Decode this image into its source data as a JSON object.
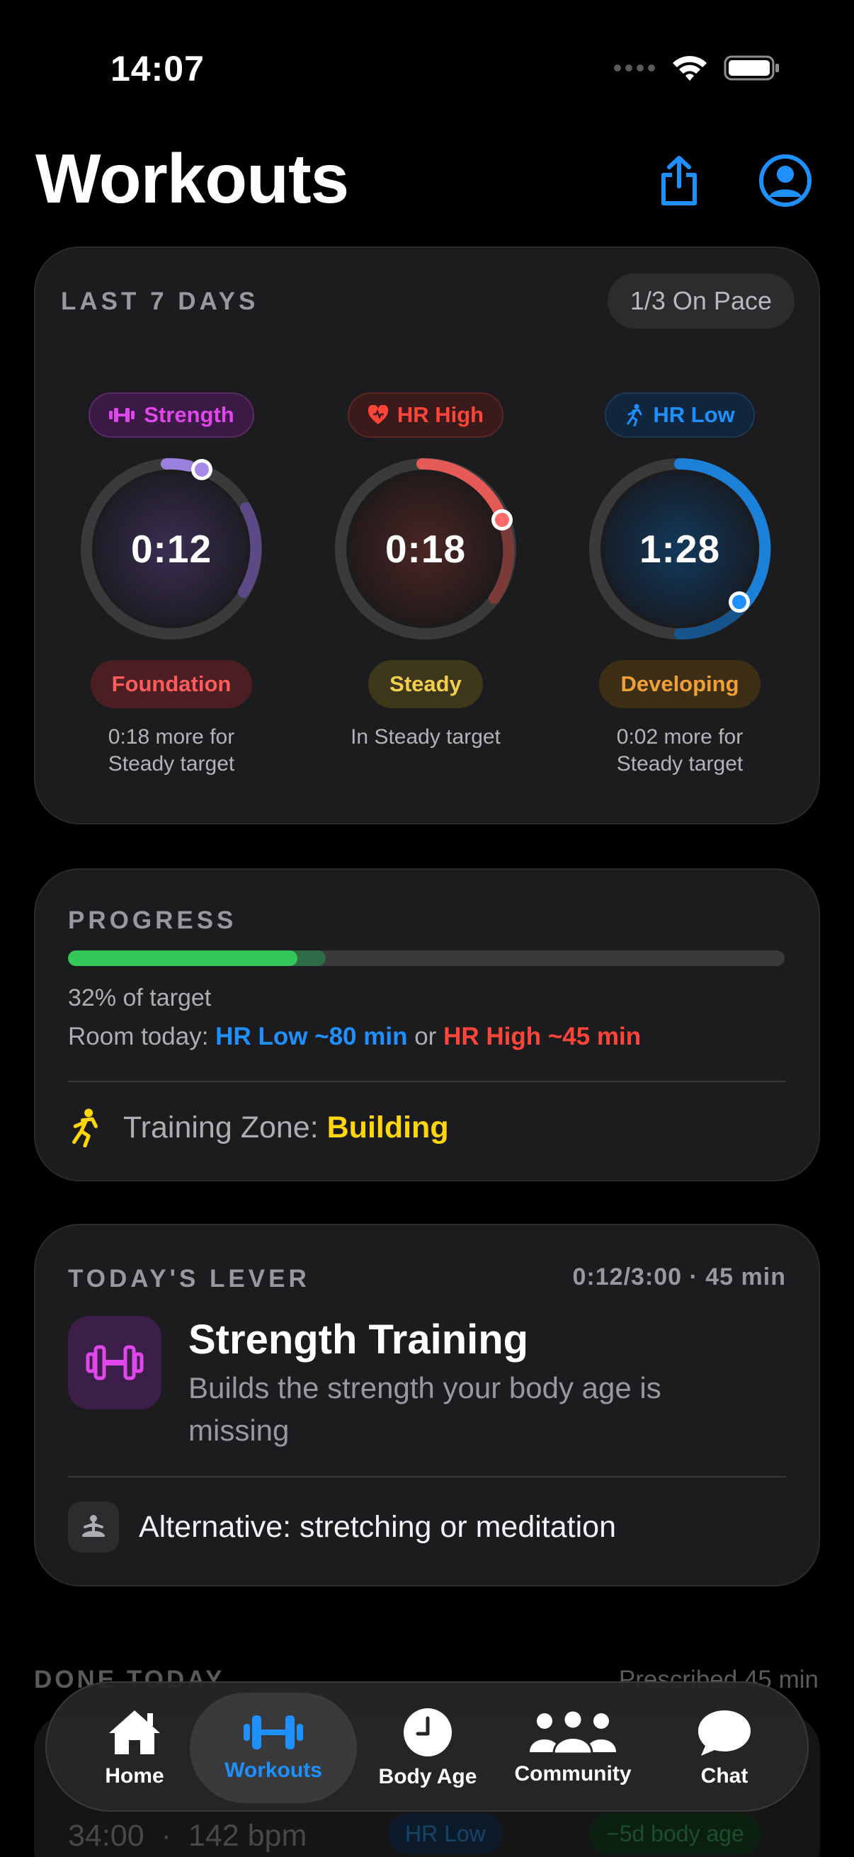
{
  "status_bar": {
    "time": "14:07"
  },
  "header": {
    "title": "Workouts"
  },
  "last7": {
    "label": "LAST 7 DAYS",
    "pace": "1/3 On Pace",
    "rings": [
      {
        "tag": "Strength",
        "value": "0:12",
        "level": "Foundation",
        "note": "0:18 more for\nSteady target",
        "progress_fraction": 0.4
      },
      {
        "tag": "HR High",
        "value": "0:18",
        "level": "Steady",
        "note": "In Steady target",
        "progress_fraction": 0.2
      },
      {
        "tag": "HR Low",
        "value": "1:28",
        "level": "Developing",
        "note": "0:02 more for\nSteady target",
        "progress_fraction": 0.5
      }
    ]
  },
  "progress": {
    "label": "PROGRESS",
    "percent": 32,
    "projected_percent": 36,
    "percent_text": "32% of target",
    "room_prefix": "Room today:",
    "room_low": "HR Low ~80 min",
    "room_or": "or",
    "room_high": "HR High ~45 min",
    "zone_prefix": "Training Zone:",
    "zone_value": "Building"
  },
  "lever": {
    "label": "TODAY'S LEVER",
    "meta": "0:12/3:00 · 45 min",
    "title": "Strength Training",
    "description": "Builds the strength your body age is missing",
    "alternative": "Alternative: stretching or meditation"
  },
  "done_today": {
    "label": "DONE TODAY",
    "meta": "Prescribed 45 min",
    "duration": "34:00",
    "bpm": "142 bpm",
    "zone_pill": "HR Low",
    "age_pill": "−5d body age"
  },
  "tabs": [
    {
      "label": "Home"
    },
    {
      "label": "Workouts"
    },
    {
      "label": "Body Age"
    },
    {
      "label": "Community"
    },
    {
      "label": "Chat"
    }
  ]
}
